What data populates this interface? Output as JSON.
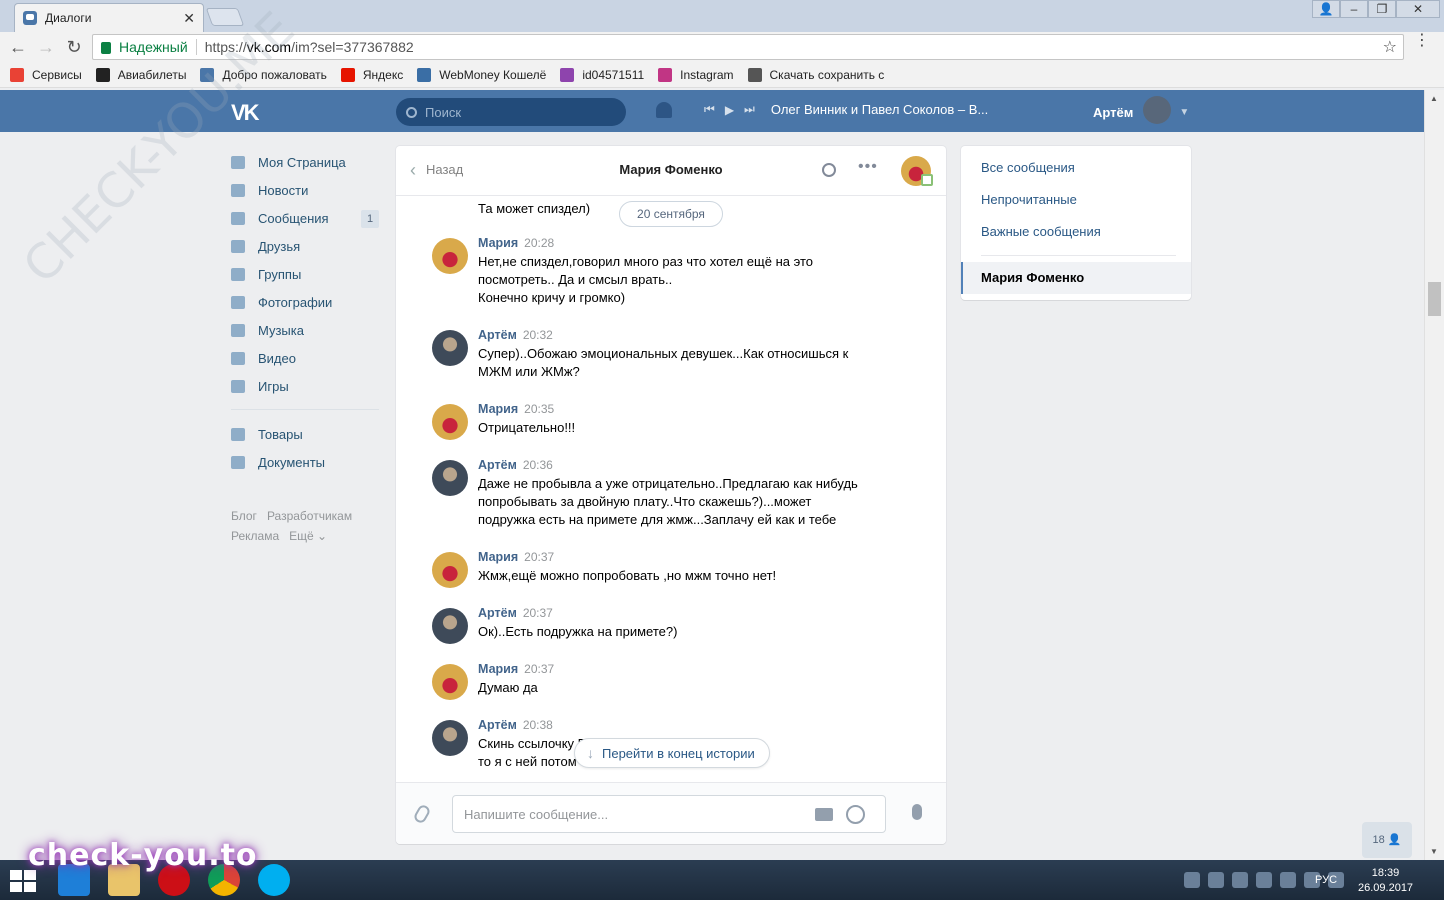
{
  "browser": {
    "tab_title": "Диалоги",
    "secure_label": "Надежный",
    "url_prefix": "https://",
    "url_host": "vk.com",
    "url_path": "/im?sel=377367882",
    "bookmarks": [
      {
        "label": "Сервисы",
        "icon": "apps-grid-icon",
        "color": "#e94235"
      },
      {
        "label": "Авиабилеты",
        "icon": "plane-icon",
        "color": "#222222"
      },
      {
        "label": "Добро пожаловать",
        "icon": "vk-icon",
        "color": "#4a76a8"
      },
      {
        "label": "Яндекс",
        "icon": "yandex-icon",
        "color": "#e61400"
      },
      {
        "label": "WebMoney Кошелё",
        "icon": "globe-icon",
        "color": "#3a6ea5"
      },
      {
        "label": "id04571511",
        "icon": "s-icon",
        "color": "#8e44ad"
      },
      {
        "label": "Instagram",
        "icon": "instagram-icon",
        "color": "#c13584"
      },
      {
        "label": "Скачать сохранить с",
        "icon": "download-icon",
        "color": "#555555"
      }
    ]
  },
  "vk": {
    "search_placeholder": "Поиск",
    "player_track": "Олег Винник и Павел Соколов – В...",
    "user_name": "Артём",
    "nav": [
      {
        "label": "Моя Страница",
        "icon": "home-icon"
      },
      {
        "label": "Новости",
        "icon": "news-icon"
      },
      {
        "label": "Сообщения",
        "icon": "messages-icon",
        "count": "1"
      },
      {
        "label": "Друзья",
        "icon": "friends-icon"
      },
      {
        "label": "Группы",
        "icon": "groups-icon"
      },
      {
        "label": "Фотографии",
        "icon": "camera-icon"
      },
      {
        "label": "Музыка",
        "icon": "music-icon"
      },
      {
        "label": "Видео",
        "icon": "video-icon"
      },
      {
        "label": "Игры",
        "icon": "games-icon"
      }
    ],
    "nav2": [
      {
        "label": "Товары",
        "icon": "bag-icon"
      },
      {
        "label": "Документы",
        "icon": "document-icon"
      }
    ],
    "footer": [
      "Блог",
      "Разработчикам",
      "Реклама",
      "Ещё ⌄"
    ]
  },
  "dialog": {
    "back_label": "Назад",
    "title": "Мария Фоменко",
    "previous_text": "Та может спиздел)",
    "date_divider": "20 сентября",
    "messages": [
      {
        "author": "Мария",
        "time": "20:28",
        "text": "Нет,не спиздел,говорил много раз что хотел ещё на это\nпосмотреть.. Да и смсыл врать..\nКонечно кричу и громко)"
      },
      {
        "author": "Артём",
        "time": "20:32",
        "text": "Супер)..Обожаю эмоциональных девушек...Как относишься к\nМЖМ или ЖМж?"
      },
      {
        "author": "Мария",
        "time": "20:35",
        "text": "Отрицательно!!!"
      },
      {
        "author": "Артём",
        "time": "20:36",
        "text": "Даже не пробывла а уже отрицательно..Предлагаю как нибудь\nпопробывать за двойную плату..Что скажешь?)...может\nподружка есть на примете для жмж...Заплачу ей как и тебе"
      },
      {
        "author": "Мария",
        "time": "20:37",
        "text": "Жмж,ещё можно попробовать ,но мжм точно нет!"
      },
      {
        "author": "Артём",
        "time": "20:37",
        "text": "Ок)..Есть подружка на примете?)"
      },
      {
        "author": "Мария",
        "time": "20:37",
        "text": "Думаю да"
      },
      {
        "author": "Артём",
        "time": "20:38",
        "text": "Скинь ссылочку                                         Если согласна\nто я с ней потом"
      }
    ],
    "jump_label": "Перейти в конец истории",
    "composer_placeholder": "Напишите сообщение..."
  },
  "right_panel": {
    "items": [
      "Все сообщения",
      "Непрочитанные",
      "Важные сообщения"
    ],
    "selected": "Мария Фоменко"
  },
  "online_count": "18",
  "taskbar": {
    "lang": "РУС",
    "time": "18:39",
    "date": "26.09.2017"
  },
  "watermark": "check-you.to",
  "watermark_diag": "CHECK-YOU.ME"
}
